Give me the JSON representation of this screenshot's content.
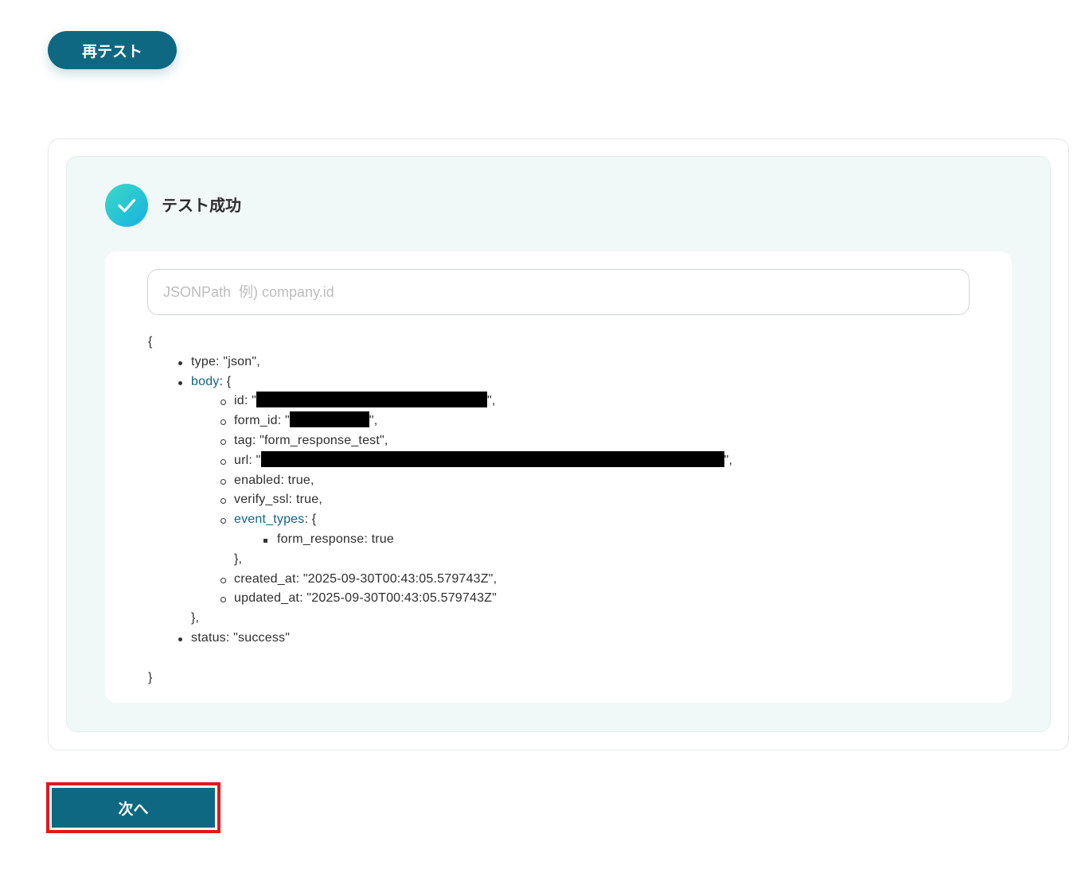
{
  "toolbar": {
    "retest_label": "再テスト"
  },
  "result": {
    "status_title": "テスト成功",
    "jsonpath_placeholder": "JSONPath  例) company.id",
    "json": {
      "open": "{",
      "close": "}",
      "type_line": "type: \"json\",",
      "body_key": "body",
      "body_open": ": {",
      "id_prefix": "id: \"",
      "id_suffix": "\",",
      "form_id_prefix": "form_id: \"",
      "form_id_suffix": "\",",
      "tag_line": "tag: \"form_response_test\",",
      "url_prefix": "url: \"",
      "url_suffix": "\",",
      "enabled_line": "enabled: true,",
      "verify_ssl_line": "verify_ssl: true,",
      "event_types_key": "event_types",
      "event_types_open": ": {",
      "form_response_line": "form_response: true",
      "event_types_close": "},",
      "created_at_line": "created_at: \"2025-09-30T00:43:05.579743Z\",",
      "updated_at_line": "updated_at: \"2025-09-30T00:43:05.579743Z\"",
      "body_close": "},",
      "status_line": "status: \"success\""
    }
  },
  "footer": {
    "next_label": "次へ"
  },
  "colors": {
    "primary": "#0e6882",
    "highlight": "#e0191f",
    "panel": "#f1f9f8",
    "check_start": "#3bd9c7",
    "check_end": "#17b2e0"
  },
  "icons": {
    "status": "check-circle-icon"
  }
}
